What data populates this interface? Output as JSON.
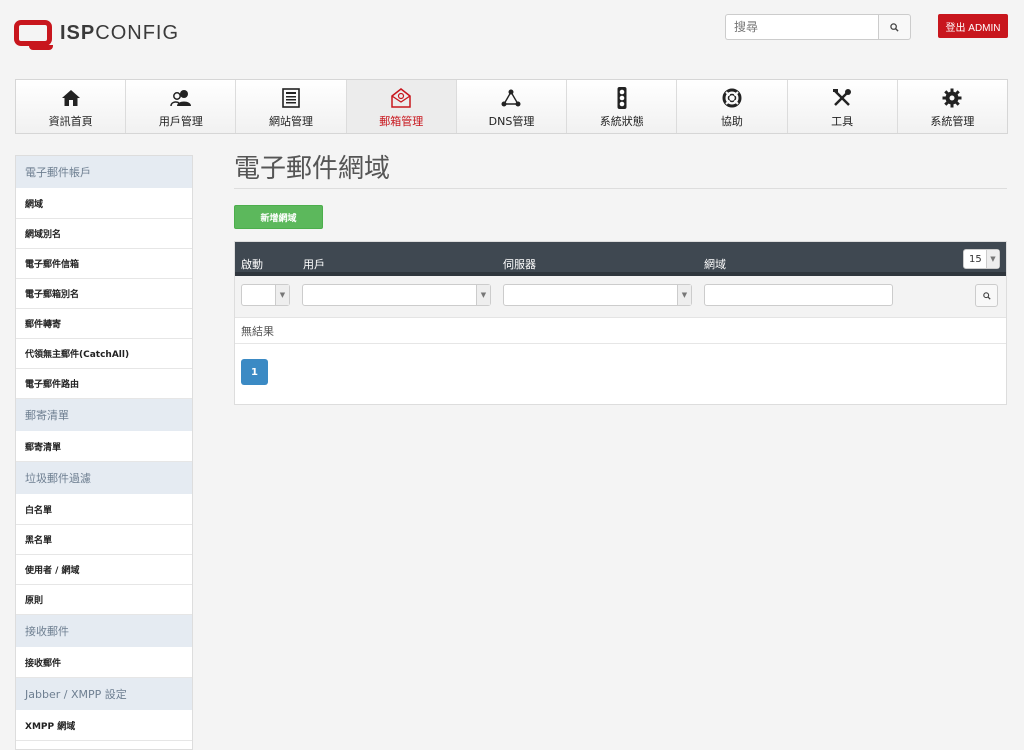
{
  "header": {
    "logo_bold": "ISP",
    "logo_light": "CONFIG",
    "search_placeholder": "搜尋",
    "logout_label": "登出 ADMIN"
  },
  "colors": {
    "brand_red": "#c8161d",
    "nav_dark": "#3f4851",
    "add_green": "#5cb85c",
    "page_blue": "#3b8ac4",
    "sidebar_head": "#e5ebf2"
  },
  "nav": [
    {
      "label": "資訊首頁",
      "icon": "home-icon"
    },
    {
      "label": "用戶管理",
      "icon": "users-icon"
    },
    {
      "label": "網站管理",
      "icon": "website-icon"
    },
    {
      "label": "郵箱管理",
      "icon": "email-icon",
      "active": true
    },
    {
      "label": "DNS管理",
      "icon": "dns-icon"
    },
    {
      "label": "系統狀態",
      "icon": "traffic-light-icon"
    },
    {
      "label": "協助",
      "icon": "help-icon"
    },
    {
      "label": "工具",
      "icon": "tools-icon"
    },
    {
      "label": "系統管理",
      "icon": "gear-icon"
    }
  ],
  "sidebar": {
    "groups": [
      {
        "title": "電子郵件帳戶",
        "items": [
          "網域",
          "網域別名",
          "電子郵件信箱",
          "電子郵箱別名",
          "郵件轉寄",
          "代領無主郵件(CatchAll)",
          "電子郵件路由"
        ]
      },
      {
        "title": "郵寄清單",
        "items": [
          "郵寄清單"
        ]
      },
      {
        "title": "垃圾郵件過濾",
        "items": [
          "白名單",
          "黑名單",
          "使用者 / 網域",
          "原則"
        ]
      },
      {
        "title": "接收郵件",
        "items": [
          "接收郵件"
        ]
      },
      {
        "title": "Jabber / XMPP 設定",
        "items": [
          "XMPP 網域"
        ]
      }
    ]
  },
  "main": {
    "title": "電子郵件網域",
    "add_button": "新增網域",
    "table": {
      "columns": [
        "啟動",
        "用戶",
        "伺服器",
        "網域"
      ],
      "per_page": "15",
      "empty_text": "無結果",
      "current_page": "1"
    }
  }
}
